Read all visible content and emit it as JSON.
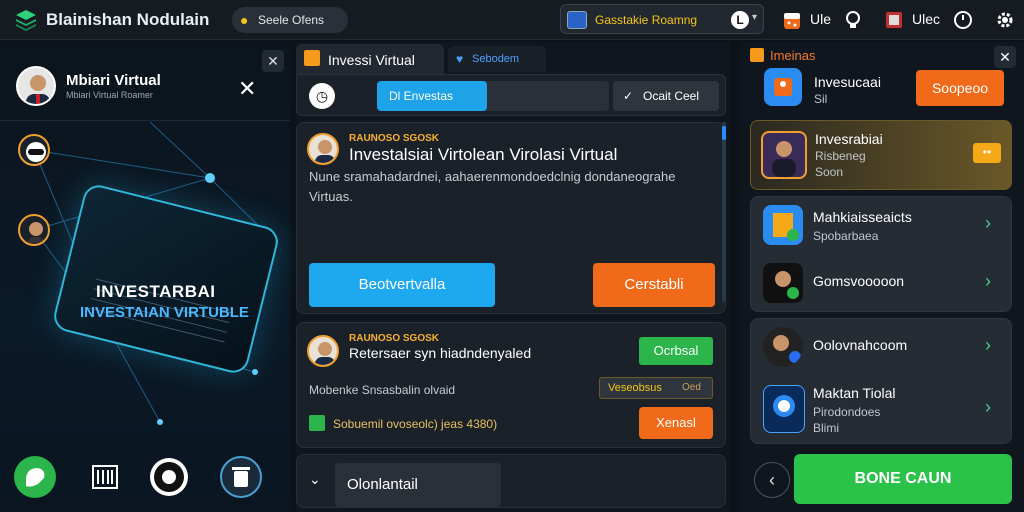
{
  "topbar": {
    "app_title": "Blainishan Nodulain",
    "search_label": "Seele Ofens",
    "mid_pill_text": "Gasstakie Roamng",
    "mid_pill_badge": "L",
    "mid_pill_chevron": "▾",
    "item1_label": "Ule",
    "item2_label": "Ulec",
    "icons": [
      "layers-logo-icon",
      "search-icon",
      "monitor-icon",
      "dice-icon",
      "lightbulb-icon",
      "flag-icon",
      "clock-icon",
      "gear-icon"
    ],
    "accent": "#f5c518"
  },
  "left_panel": {
    "close_label": "✕",
    "profile_name": "Mbiari Virtual",
    "profile_sub": "Mbiari Virtual Roamer",
    "big_close": "✕",
    "hero_title": "INVESTARBAI",
    "hero_subtitle": "INVESTAIAN VIRTUBLE",
    "bottom_icons": [
      "chat-icon",
      "barcode-icon",
      "face-icon",
      "trash-icon"
    ]
  },
  "middle": {
    "tab_active_label": "Invessi Virtual",
    "tab2_label": "Sebodem",
    "toolbar": {
      "segment_active": "Dl Envestas",
      "segment_right": "Ocait Ceel"
    },
    "card1": {
      "tag": "RAUNOSO SGOSK",
      "title": "Investalsiai Virtolean Virolasi Virtual",
      "desc": "Nune sramahadardnei, aahaerenmondoedclnig dondaneograhe Virtuas.",
      "btn_blue": "Beotvertvalla",
      "btn_orange": "Cerstabli"
    },
    "card2": {
      "tag": "RAUNOSO SGOSK",
      "title": "Retersaer syn hiadndenyaled",
      "btn_green": "Ocrbsal",
      "line2": "Mobenke Snsasbalin olvaid",
      "tag_pill": "Veseobsus",
      "tag_pill_sub": "Oed",
      "line3": "Sobuemil ovoseolc) jeas 4380)",
      "btn_orange": "Xenasl"
    },
    "card3": {
      "label": "Olonlantail"
    }
  },
  "right_panel": {
    "header_label": "Imeinas",
    "close_label": "✕",
    "rows": [
      {
        "title": "Invesucaai",
        "sub": "Sil",
        "button": "Soopeoo"
      },
      {
        "title": "Invesrabiai",
        "sub": "Risbeneg",
        "sub2": "Soon",
        "badge": "••"
      },
      {
        "title": "Mahkiaisseaicts",
        "sub": "Spobarbaea"
      },
      {
        "title": "Gomsvooooon",
        "sub": ""
      },
      {
        "title": "Oolovnahcoom",
        "sub": ""
      },
      {
        "title": "Maktan Tiolal",
        "sub": "Pirodondoes",
        "sub2": "Blimi"
      }
    ],
    "bottom_button": "BONE CAUN",
    "back_icon": "chevron-left-icon"
  }
}
